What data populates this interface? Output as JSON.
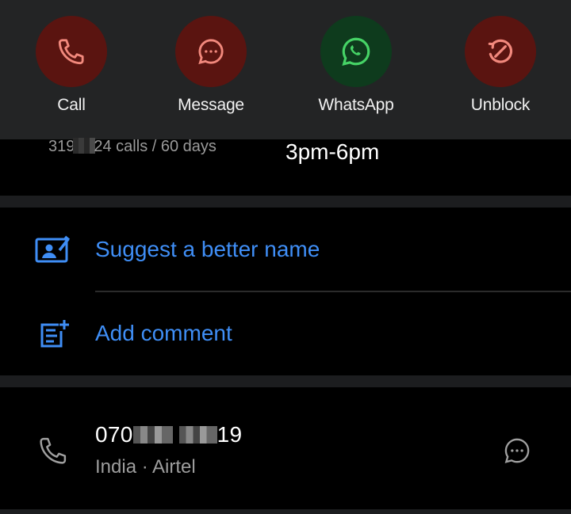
{
  "actions": [
    {
      "label": "Call",
      "icon": "phone-icon",
      "bg": "#5a1410",
      "fg": "#f2897d"
    },
    {
      "label": "Message",
      "icon": "message-icon",
      "bg": "#5a1410",
      "fg": "#f2897d"
    },
    {
      "label": "WhatsApp",
      "icon": "whatsapp-icon",
      "bg": "#0e3b1d",
      "fg": "#46d366"
    },
    {
      "label": "Unblock",
      "icon": "unblock-icon",
      "bg": "#5a1410",
      "fg": "#f2897d"
    }
  ],
  "stats": {
    "prefix": "319",
    "suffix": "24 calls / 60 days",
    "hours": "3pm-6pm"
  },
  "options": {
    "suggest_label": "Suggest a better name",
    "comment_label": "Add comment"
  },
  "contact": {
    "number_prefix": "070",
    "number_suffix": "19",
    "carrier": "India · Airtel"
  },
  "colors": {
    "accent": "#3f8ef6",
    "panel": "#232425",
    "band": "#1c1d1f"
  }
}
